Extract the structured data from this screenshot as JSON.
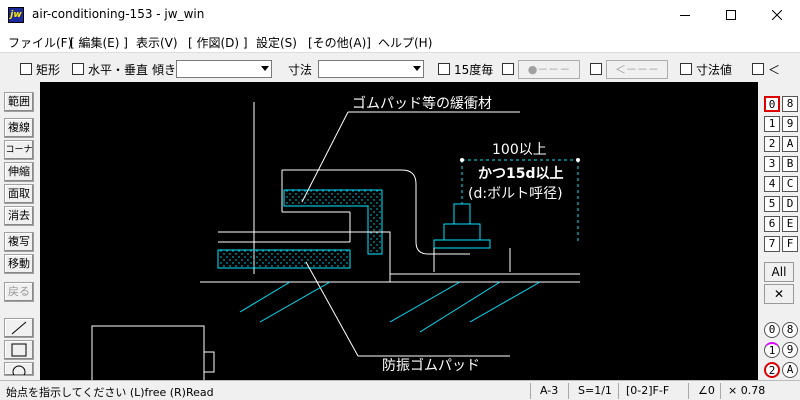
{
  "window": {
    "title": "air-conditioning-153 - jw_win",
    "icon_text": "jw",
    "controls": [
      "minimize-icon",
      "maximize-icon",
      "close-icon"
    ]
  },
  "menu": [
    "ファイル(F)",
    "[ 編集(E) ]",
    "表示(V)",
    "[ 作図(D) ]",
    "設定(S)",
    "[その他(A)]",
    "ヘルプ(H)"
  ],
  "toolbar": {
    "rect_label": "矩形",
    "hv_label": "水平・垂直",
    "tilt_label": "傾き",
    "dim_label": "寸法",
    "deg15_label": "15度毎",
    "btn_dot": "●－－－",
    "btn_arrow": "＜－－－",
    "dimval_label": "寸法値",
    "lt_label": "＜"
  },
  "left_tools": [
    "範囲",
    "複線",
    "コーナー",
    "伸縮",
    "面取",
    "消去",
    "複写",
    "移動",
    "戻る"
  ],
  "right_tools": {
    "pairs": [
      [
        "0",
        "8"
      ],
      [
        "1",
        "9"
      ],
      [
        "2",
        "A"
      ],
      [
        "3",
        "B"
      ],
      [
        "4",
        "C"
      ],
      [
        "5",
        "D"
      ],
      [
        "6",
        "E"
      ],
      [
        "7",
        "F"
      ]
    ],
    "all": "All",
    "x": "✕",
    "circle_pairs": [
      [
        "0",
        "8"
      ],
      [
        "1",
        "9"
      ],
      [
        "2",
        "A"
      ]
    ]
  },
  "drawing": {
    "label_top": "ゴムパッド等の緩衝材",
    "label_dim": "100以上",
    "label_and": "かつ15d以上",
    "label_bolt": "(d:ボルト呼径)",
    "label_bottom": "防振ゴムパッド"
  },
  "status": {
    "prompt": "始点を指示してください (L)free (R)Read",
    "sheet": "A-3",
    "scale": "S=1/1",
    "layer": "[0-2]F-F",
    "angle": "∠0",
    "ratio": "× 0.78"
  },
  "colors": {
    "canvas": "#000000",
    "cyan": "#00e5ff",
    "white": "#ffffff",
    "yellow": "#ffff00"
  }
}
